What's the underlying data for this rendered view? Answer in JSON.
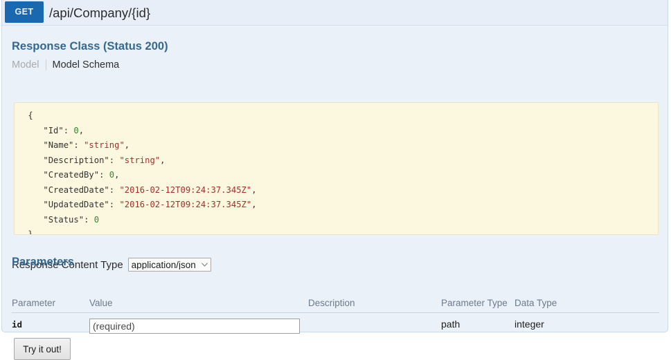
{
  "operation": {
    "method": "GET",
    "path": "/api/Company/{id}"
  },
  "response_class": {
    "title": "Response Class (Status 200)",
    "tabs": [
      {
        "label": "Model",
        "active": false
      },
      {
        "label": "Model Schema",
        "active": true
      }
    ],
    "schema_lines": [
      {
        "indent": 0,
        "parts": [
          {
            "t": "{",
            "c": "punct"
          }
        ]
      },
      {
        "indent": 1,
        "parts": [
          {
            "t": "\"Id\"",
            "c": "key"
          },
          {
            "t": ": ",
            "c": "punct"
          },
          {
            "t": "0",
            "c": "num"
          },
          {
            "t": ",",
            "c": "punct"
          }
        ]
      },
      {
        "indent": 1,
        "parts": [
          {
            "t": "\"Name\"",
            "c": "key"
          },
          {
            "t": ": ",
            "c": "punct"
          },
          {
            "t": "\"string\"",
            "c": "str"
          },
          {
            "t": ",",
            "c": "punct"
          }
        ]
      },
      {
        "indent": 1,
        "parts": [
          {
            "t": "\"Description\"",
            "c": "key"
          },
          {
            "t": ": ",
            "c": "punct"
          },
          {
            "t": "\"string\"",
            "c": "str"
          },
          {
            "t": ",",
            "c": "punct"
          }
        ]
      },
      {
        "indent": 1,
        "parts": [
          {
            "t": "\"CreatedBy\"",
            "c": "key"
          },
          {
            "t": ": ",
            "c": "punct"
          },
          {
            "t": "0",
            "c": "num"
          },
          {
            "t": ",",
            "c": "punct"
          }
        ]
      },
      {
        "indent": 1,
        "parts": [
          {
            "t": "\"CreatedDate\"",
            "c": "key"
          },
          {
            "t": ": ",
            "c": "punct"
          },
          {
            "t": "\"2016-02-12T09:24:37.345Z\"",
            "c": "str"
          },
          {
            "t": ",",
            "c": "punct"
          }
        ]
      },
      {
        "indent": 1,
        "parts": [
          {
            "t": "\"UpdatedDate\"",
            "c": "key"
          },
          {
            "t": ": ",
            "c": "punct"
          },
          {
            "t": "\"2016-02-12T09:24:37.345Z\"",
            "c": "str"
          },
          {
            "t": ",",
            "c": "punct"
          }
        ]
      },
      {
        "indent": 1,
        "parts": [
          {
            "t": "\"Status\"",
            "c": "key"
          },
          {
            "t": ": ",
            "c": "punct"
          },
          {
            "t": "0",
            "c": "num"
          }
        ]
      },
      {
        "indent": 0,
        "parts": [
          {
            "t": "}",
            "c": "punct"
          }
        ]
      }
    ]
  },
  "response_content_type": {
    "label": "Response Content Type",
    "selected": "application/json",
    "options": [
      "application/json"
    ]
  },
  "parameters": {
    "title": "Parameters",
    "columns": [
      "Parameter",
      "Value",
      "Description",
      "Parameter Type",
      "Data Type"
    ],
    "rows": [
      {
        "name": "id",
        "value": "",
        "placeholder": "(required)",
        "description": "",
        "parameter_type": "path",
        "data_type": "integer"
      }
    ]
  },
  "submit": {
    "label": "Try it out!"
  },
  "colors": {
    "method_badge": "#1a69b0",
    "section_heading": "#34698f",
    "schema_background": "#fcf8e0",
    "panel_background": "#ebf1f8",
    "panel_border": "#c8d9ee",
    "string_token": "#a0302a",
    "number_token": "#2c8a2c"
  }
}
